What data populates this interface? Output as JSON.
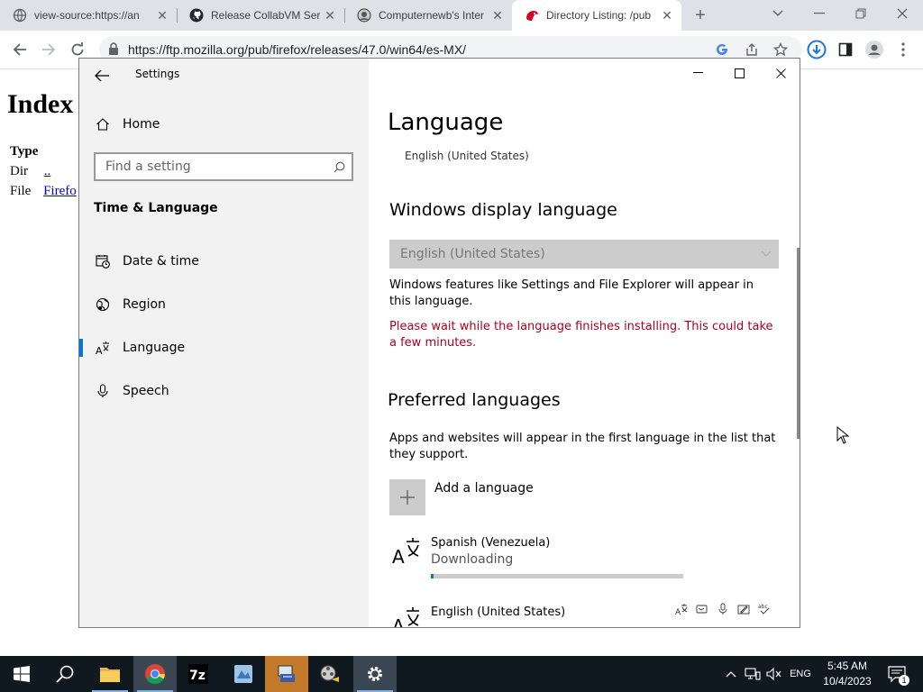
{
  "browser": {
    "tabs": [
      {
        "title": "view-source:https://an",
        "favicon": "globe-icon",
        "active": false
      },
      {
        "title": "Release CollabVM Ser",
        "favicon": "github-icon",
        "active": false
      },
      {
        "title": "Computernewb's Inter",
        "favicon": "computernewb-icon",
        "active": false
      },
      {
        "title": "Directory Listing: /pub",
        "favicon": "mozilla-icon",
        "active": true
      }
    ],
    "url": "https://ftp.mozilla.org/pub/firefox/releases/47.0/win64/es-MX/"
  },
  "page": {
    "heading": "Index",
    "col_type": "Type",
    "row1_type": "Dir",
    "row1_link": "..",
    "row2_type": "File",
    "row2_link": "Firefo"
  },
  "settings": {
    "app_title": "Settings",
    "nav": {
      "home": "Home",
      "search_placeholder": "Find a setting",
      "section": "Time & Language",
      "items": [
        {
          "label": "Date & time",
          "icon": "calendar-clock-icon"
        },
        {
          "label": "Region",
          "icon": "globe-region-icon"
        },
        {
          "label": "Language",
          "icon": "language-icon",
          "selected": true
        },
        {
          "label": "Speech",
          "icon": "microphone-icon"
        }
      ]
    },
    "content": {
      "title": "Language",
      "cut_text": "English (United States)",
      "display_heading": "Windows display language",
      "display_value": "English (United States)",
      "display_desc": "Windows features like Settings and File Explorer will appear in this language.",
      "warning": "Please wait while the language finishes installing. This could take a few minutes.",
      "preferred_heading": "Preferred languages",
      "preferred_desc": "Apps and websites will appear in the first language in the list that they support.",
      "add_language": "Add a language",
      "languages": [
        {
          "name": "Spanish (Venezuela)",
          "status": "Downloading",
          "progress": 0.01
        },
        {
          "name": "English (United States)"
        }
      ]
    }
  },
  "taskbar": {
    "time": "5:45 AM",
    "date": "10/4/2023",
    "lang": "ENG",
    "notification_count": "1"
  },
  "colors": {
    "accent": "#0078d7",
    "warning": "#b00020",
    "taskbar": "#101820"
  }
}
